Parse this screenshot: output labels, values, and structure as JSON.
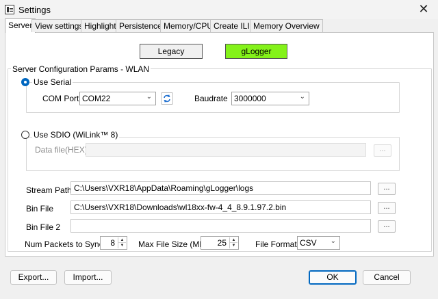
{
  "window": {
    "title": "Settings",
    "close_glyph": "✕",
    "icon": "app-settings-icon"
  },
  "tabs": [
    {
      "label": "Server",
      "active": true
    },
    {
      "label": "View settings",
      "active": false
    },
    {
      "label": "Highlight",
      "active": false
    },
    {
      "label": "Persistence",
      "active": false
    },
    {
      "label": "Memory/CPU",
      "active": false
    },
    {
      "label": "Create ILI",
      "active": false
    },
    {
      "label": "Memory Overview",
      "active": false
    }
  ],
  "modes": {
    "legacy": "Legacy",
    "glogger": "gLogger",
    "glogger_color": "#84f21a"
  },
  "group": {
    "title": "Server Configuration Params - WLAN",
    "serial": {
      "label": "Use Serial",
      "selected": true,
      "com_port_label": "COM Port",
      "com_port_value": "COM22",
      "baudrate_label": "Baudrate",
      "baudrate_value": "3000000"
    },
    "sdio": {
      "label": "Use SDIO (WiLink™ 8)",
      "selected": false,
      "data_file_label": "Data file(HEX)",
      "data_file_value": "",
      "browse": "..."
    },
    "stream_path": {
      "label": "Stream Path",
      "value": "C:\\Users\\VXR18\\AppData\\Roaming\\gLogger\\logs",
      "browse": "..."
    },
    "bin_file": {
      "label": "Bin File",
      "value": "C:\\Users\\VXR18\\Downloads\\wl18xx-fw-4_4_8.9.1.97.2.bin",
      "browse": "..."
    },
    "bin_file_2": {
      "label": "Bin File 2",
      "value": "",
      "browse": "..."
    },
    "num_packets": {
      "label": "Num Packets to Sync",
      "value": "8"
    },
    "max_file_size": {
      "label": "Max File Size (MB)",
      "value": "25"
    },
    "file_format": {
      "label": "File Format",
      "value": "CSV"
    }
  },
  "buttons": {
    "export": "Export...",
    "import": "Import...",
    "ok": "OK",
    "cancel": "Cancel"
  }
}
